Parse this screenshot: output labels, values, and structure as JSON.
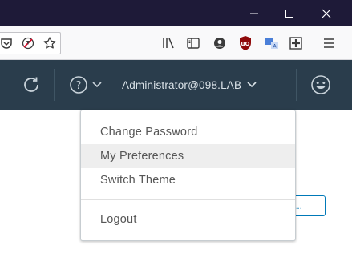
{
  "window": {
    "controls": [
      {
        "name": "minimize-icon"
      },
      {
        "name": "maximize-icon"
      },
      {
        "name": "close-icon"
      }
    ]
  },
  "toolbar": {
    "icons": [
      "pocket-icon",
      "tracking-protection-icon",
      "bookmark-star-icon",
      "library-icon",
      "sidebar-icon",
      "account-icon",
      "ublock-icon",
      "translate-icon",
      "extension-icon",
      "hamburger-menu-icon"
    ]
  },
  "header": {
    "refresh_icon": "refresh-icon",
    "help_icon": "help-circle-icon",
    "user_label": "Administrator@098.LAB",
    "avatar_icon": "smiley-icon",
    "bg_color": "#2a3d4c"
  },
  "content": {
    "button_label": "..."
  },
  "dropdown": {
    "items": [
      {
        "label": "Change Password"
      },
      {
        "label": "My Preferences",
        "active": true
      },
      {
        "label": "Switch Theme"
      },
      {
        "label": "Logout"
      }
    ]
  }
}
